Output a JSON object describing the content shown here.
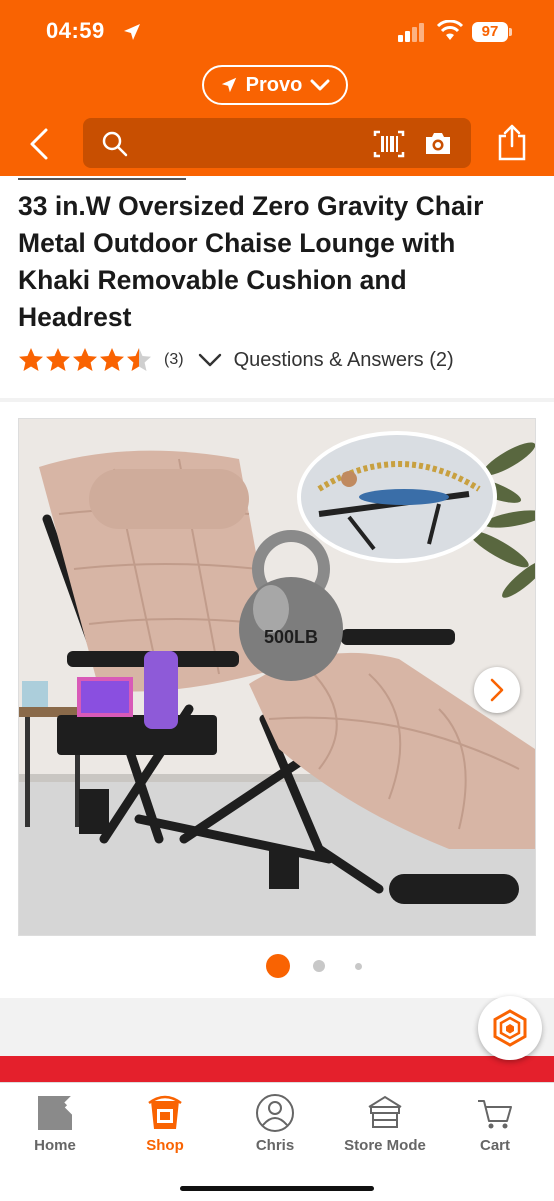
{
  "status_bar": {
    "time": "04:59",
    "battery": "97"
  },
  "header": {
    "location": "Provo",
    "search": {
      "placeholder": ""
    },
    "brand_color": "#f96302"
  },
  "product": {
    "title": "33 in.W Oversized Zero Gravity Chair Metal Outdoor Chaise Lounge with Khaki Removable Cushion and Headrest",
    "rating": 4.5,
    "rating_max": 5,
    "review_count": "(3)",
    "qa_label": "Questions & Answers (2)"
  },
  "gallery": {
    "image_text": "500LB",
    "image_count": 3,
    "current_index": 1
  },
  "tabs": [
    {
      "label": "Home",
      "icon": "home-depot-logo-icon",
      "active": false
    },
    {
      "label": "Shop",
      "icon": "shop-bucket-icon",
      "active": true
    },
    {
      "label": "Chris",
      "icon": "person-icon",
      "active": false
    },
    {
      "label": "Store Mode",
      "icon": "store-icon",
      "active": false
    },
    {
      "label": "Cart",
      "icon": "cart-icon",
      "active": false
    }
  ],
  "colors": {
    "accent": "#f96302",
    "star": "#f96302",
    "strip": "#e4202c"
  }
}
